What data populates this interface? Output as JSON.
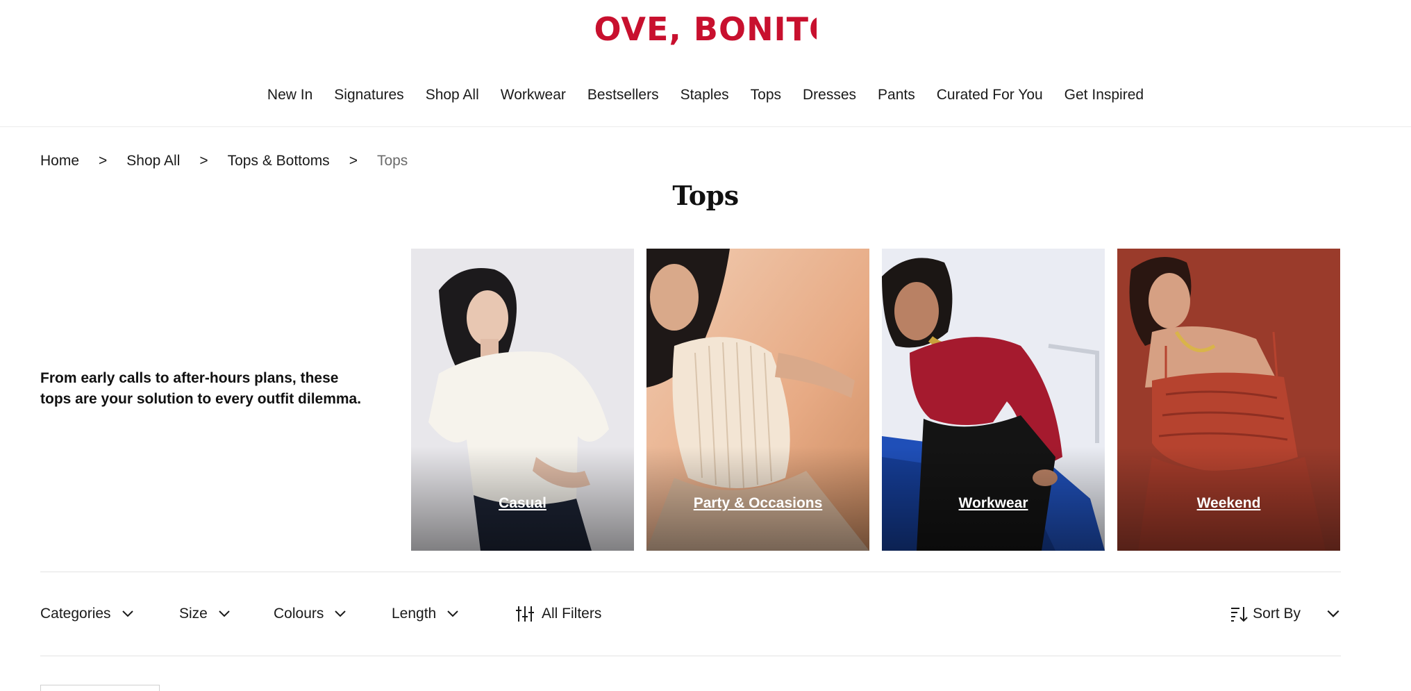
{
  "brand": {
    "logo_text": "LOVE, BONITO",
    "color": "#c8102e"
  },
  "nav": {
    "items": [
      {
        "label": "New In"
      },
      {
        "label": "Signatures"
      },
      {
        "label": "Shop All"
      },
      {
        "label": "Workwear"
      },
      {
        "label": "Bestsellers"
      },
      {
        "label": "Staples"
      },
      {
        "label": "Tops"
      },
      {
        "label": "Dresses"
      },
      {
        "label": "Pants"
      },
      {
        "label": "Curated For You"
      },
      {
        "label": "Get Inspired"
      }
    ]
  },
  "breadcrumb": {
    "items": [
      {
        "label": "Home"
      },
      {
        "label": "Shop All"
      },
      {
        "label": "Tops & Bottoms"
      },
      {
        "label": "Tops"
      }
    ],
    "separator": ">"
  },
  "page": {
    "title": "Tops",
    "intro": "From early calls to after-hours plans, these tops are your solution to every outfit dilemma."
  },
  "tiles": [
    {
      "label": "Casual",
      "bg": "#e9e9ec"
    },
    {
      "label": "Party & Occasions",
      "bg": "#e7b79a"
    },
    {
      "label": "Workwear",
      "bg": "#e8e9f0"
    },
    {
      "label": "Weekend",
      "bg": "#9c3a2c"
    }
  ],
  "filters": {
    "items": [
      {
        "label": "Categories"
      },
      {
        "label": "Size"
      },
      {
        "label": "Colours"
      },
      {
        "label": "Length"
      }
    ],
    "all_filters_label": "All Filters",
    "sort_label": "Sort By"
  }
}
